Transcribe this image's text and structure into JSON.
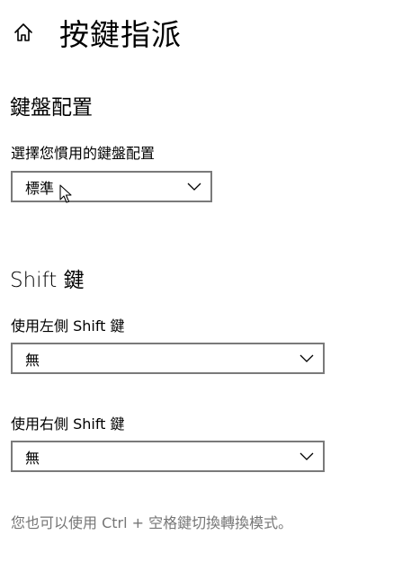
{
  "header": {
    "title": "按鍵指派",
    "home_icon": "home-icon"
  },
  "keyboard_layout": {
    "section_title": "鍵盤配置",
    "label": "選擇您慣用的鍵盤配置",
    "selected": "標準"
  },
  "shift_keys": {
    "section_title": "Shift 鍵",
    "left_label": "使用左側 Shift 鍵",
    "left_selected": "無",
    "right_label": "使用右側 Shift 鍵",
    "right_selected": "無"
  },
  "hint": "您也可以使用 Ctrl + 空格鍵切換轉換模式。",
  "colors": {
    "dropdown_border": "#7a7a7a",
    "hint_text": "#767676"
  }
}
